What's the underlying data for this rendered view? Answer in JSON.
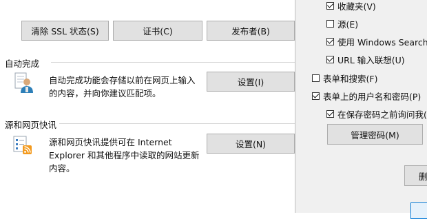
{
  "content": {
    "buttons_top": {
      "clear_ssl": "清除 SSL 状态(S)",
      "certificates": "证书(C)",
      "publishers": "发布者(B)"
    },
    "autocomplete": {
      "title": "自动完成",
      "description_line1": "自动完成功能会存储以前在网页上输入",
      "description_line2": "的内容，并向你建议匹配项。",
      "settings_button": "设置(I)"
    },
    "feeds": {
      "title": "源和网页快讯",
      "description_line1": "源和网页快讯提供可在 Internet",
      "description_line2": "Explorer 和其他程序中读取的网站更新",
      "description_line3": "内容。",
      "settings_button": "设置(N)"
    }
  },
  "autocomplete_dialog": {
    "items": [
      {
        "label": "收藏夹(V)",
        "checked": true
      },
      {
        "label": "源(E)",
        "checked": false
      },
      {
        "label": "使用 Windows Search 获",
        "checked": true
      },
      {
        "label": "URL 输入联想(U)",
        "checked": true
      },
      {
        "label": "表单和搜索(F)",
        "checked": false
      },
      {
        "label": "表单上的用户名和密码(P)",
        "checked": true
      },
      {
        "label": "在保存密码之前询问我(S",
        "checked": true
      }
    ],
    "manage_passwords_button": "管理密码(M)",
    "delete_button_partial": "删"
  }
}
